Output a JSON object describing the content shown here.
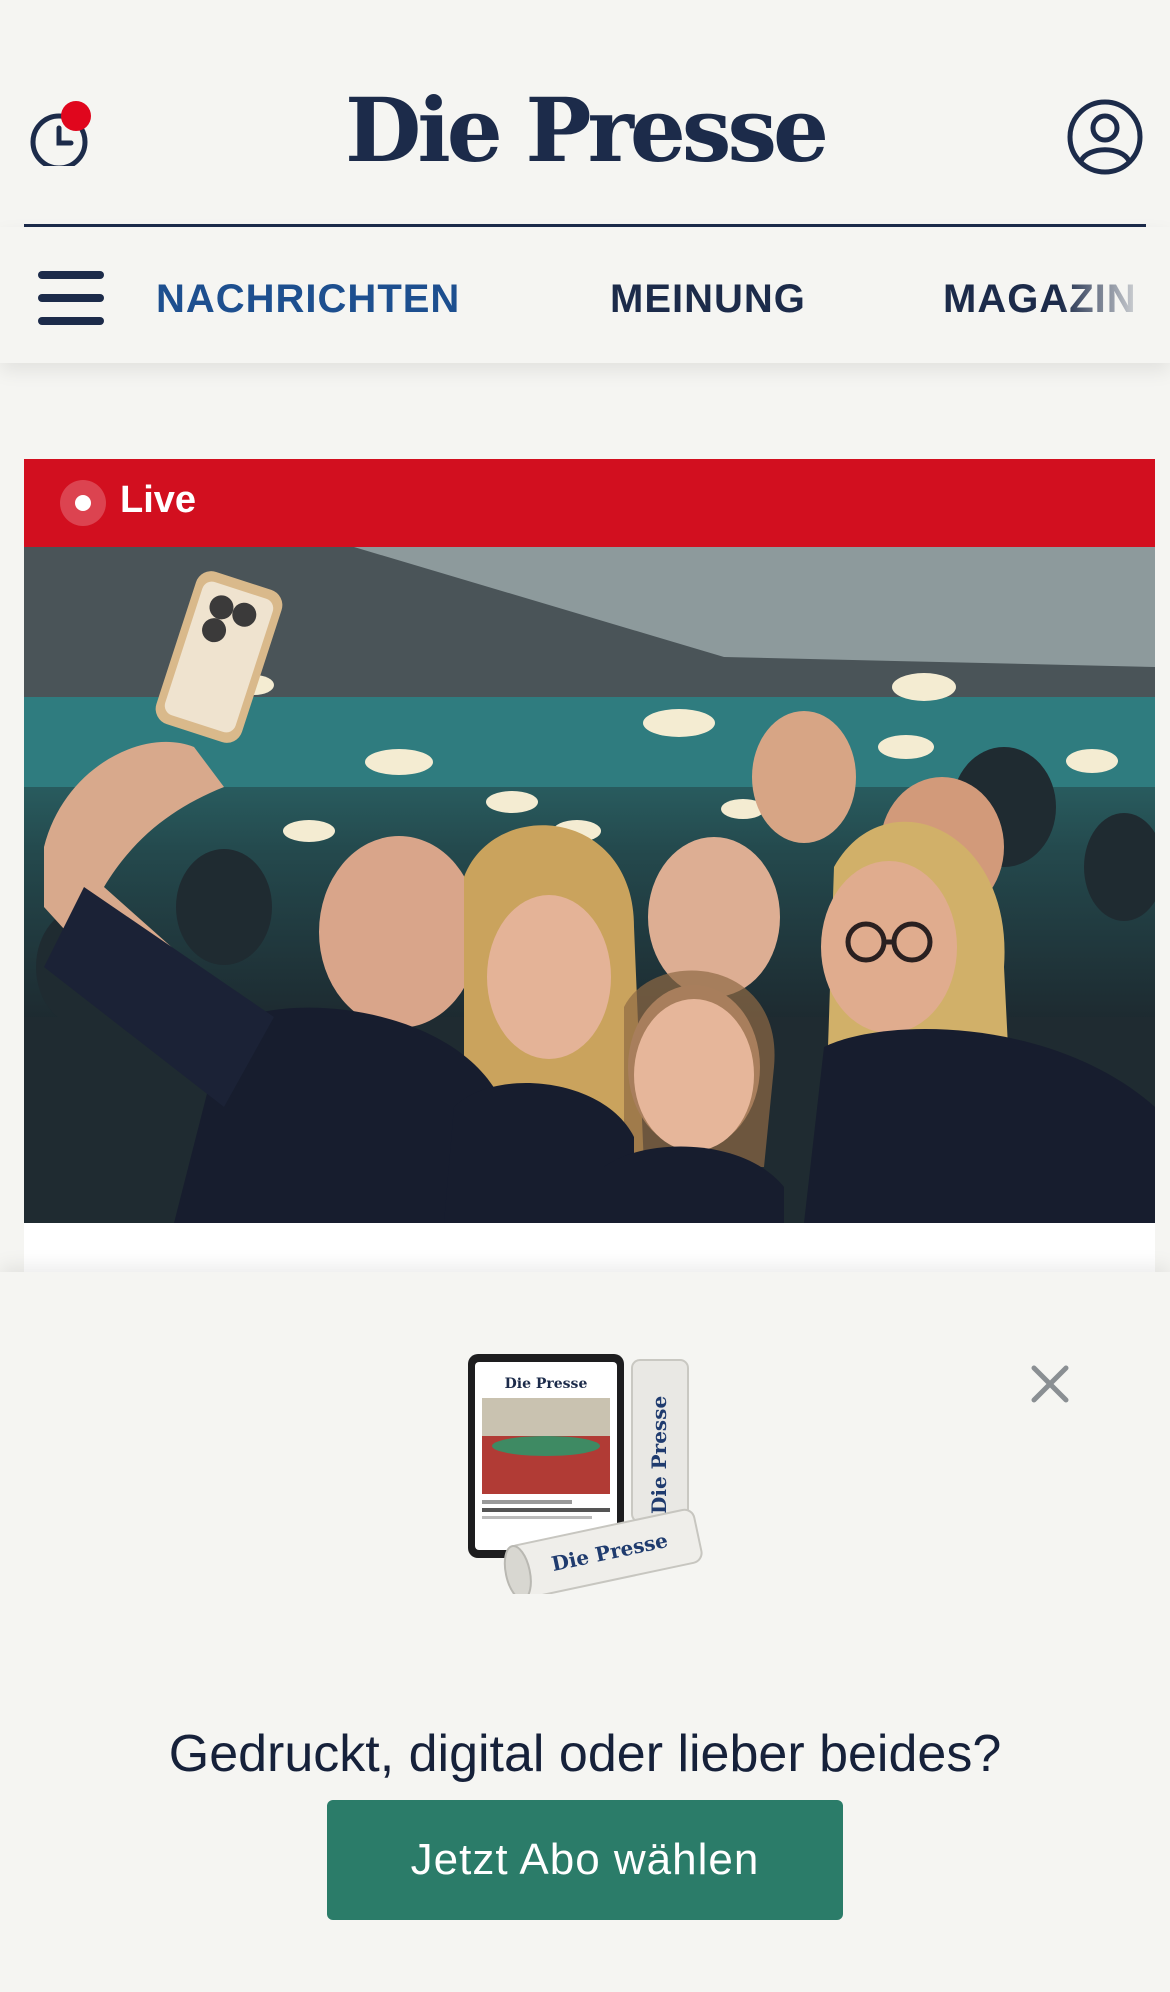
{
  "header": {
    "logo": "Die Presse",
    "history_icon": "clock-history-icon",
    "account_icon": "user-account-icon",
    "notification_color": "#e0061d"
  },
  "nav": {
    "menu_icon": "hamburger-menu-icon",
    "items": [
      {
        "label": "NACHRICHTEN",
        "active": true
      },
      {
        "label": "MEINUNG",
        "active": false
      },
      {
        "label": "MAGAZIN",
        "active": false
      }
    ]
  },
  "article": {
    "badge": "Live",
    "image_alt": "Gruppe lächelnder junger Menschen macht ein Selfie auf einer Wahlparty",
    "badge_color": "#d20f1f"
  },
  "paywall": {
    "close_icon": "close-icon",
    "promo_image": "tablet-and-newspaper-illustration",
    "promo_logo": "Die Presse",
    "headline": "Gedruckt, digital oder lieber beides?",
    "cta_label": "Jetzt Abo wählen",
    "cta_color": "#2b7c69"
  }
}
